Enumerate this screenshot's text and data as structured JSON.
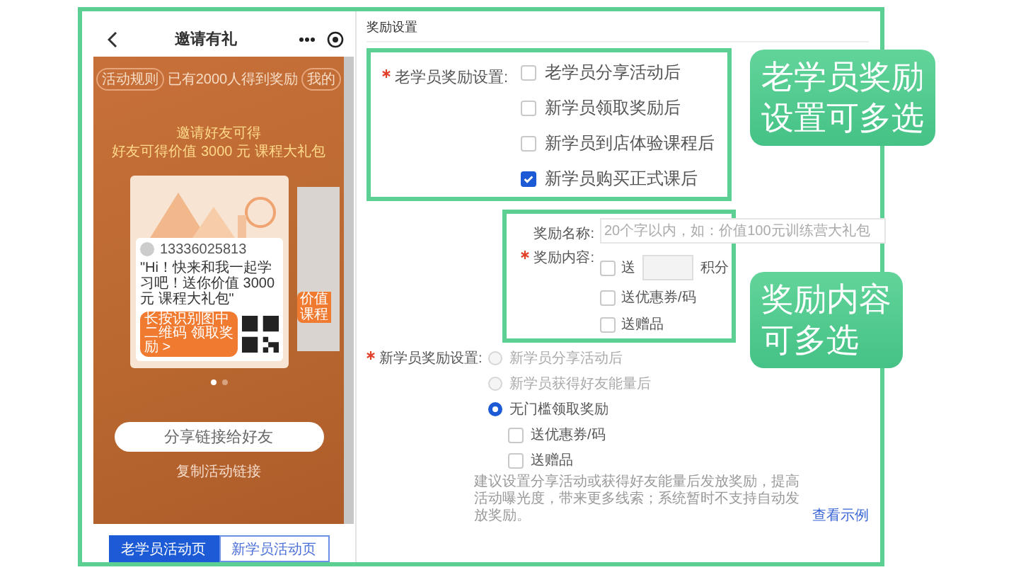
{
  "phone": {
    "title": "邀请有礼",
    "top_bar": {
      "left_pill": "活动规则",
      "center": "已有2000人得到奖励",
      "right_pill": "我的"
    },
    "headline": [
      "邀请好友可得",
      "好友可得价值 3000 元 课程大礼包"
    ],
    "poster": {
      "phone_number": "13336025813",
      "message": "\"Hi！快来和我一起学习吧！送你价值 3000 元 课程大礼包\"",
      "scan_button": "长按识别图中二维码 领取奖励 >"
    },
    "side_tag": "价值课程",
    "pager": [
      {
        "selected": true
      },
      {
        "selected": false
      }
    ],
    "share_button": "分享链接给好友",
    "copy_link": "复制活动链接"
  },
  "page_tabs": [
    {
      "label": "老学员活动页",
      "selected": true
    },
    {
      "label": "新学员活动页",
      "selected": false
    }
  ],
  "settings": {
    "section_title": "奖励设置",
    "old_student": {
      "label": "老学员奖励设置:",
      "required": true,
      "options": [
        {
          "label": "老学员分享活动后",
          "checked": false
        },
        {
          "label": "新学员领取奖励后",
          "checked": false
        },
        {
          "label": "新学员到店体验课程后",
          "checked": false
        },
        {
          "label": "新学员购买正式课后",
          "checked": true
        }
      ]
    },
    "reward_name": {
      "label": "奖励名称:",
      "placeholder": "20个字以内，如：价值100元训练营大礼包"
    },
    "reward_content": {
      "label": "奖励内容:",
      "required": true,
      "options": [
        {
          "kind": "points",
          "label": "送",
          "unit": "积分",
          "checked": false
        },
        {
          "kind": "plain",
          "label": "送优惠券/码",
          "checked": false
        },
        {
          "kind": "plain",
          "label": "送赠品",
          "checked": false
        }
      ]
    },
    "new_student": {
      "label": "新学员奖励设置:",
      "required": true,
      "options": [
        {
          "label": "新学员分享活动后",
          "selected": false,
          "disabled": true
        },
        {
          "label": "新学员获得好友能量后",
          "selected": false,
          "disabled": true
        },
        {
          "label": "无门槛领取奖励",
          "selected": true,
          "disabled": false
        }
      ],
      "rewards": [
        {
          "label": "送优惠券/码",
          "checked": false
        },
        {
          "label": "送赠品",
          "checked": false
        }
      ],
      "hint": "建议设置分享活动或获得好友能量后发放奖励，提高活动曝光度，带来更多线索；系统暂时不支持自动发放奖励。",
      "hint_link": "查看示例"
    }
  },
  "callouts": [
    {
      "lines": [
        "老学员奖励",
        "设置可多选"
      ]
    },
    {
      "lines": [
        "奖励内容",
        "可多选"
      ]
    }
  ]
}
